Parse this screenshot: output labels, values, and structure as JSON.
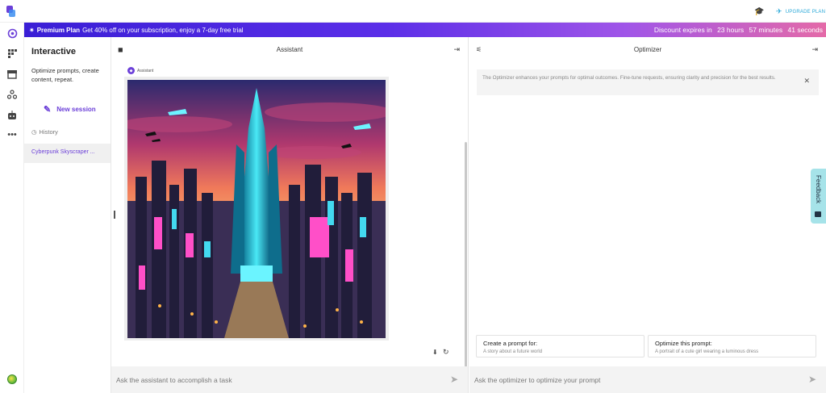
{
  "topbar": {
    "logo": "app-logo",
    "course_icon": "graduation-cap-icon",
    "upgrade_label": "UPGRADE PLAN",
    "upgrade_icon": "rocket-icon"
  },
  "promo": {
    "icon": "sparkle-icon",
    "plan_name": "Premium Plan",
    "message": "Get 40% off on your subscription, enjoy a 7-day free trial",
    "expires_label": "Discount expires in",
    "hours": "23 hours",
    "minutes": "57 minutes",
    "seconds": "41 seconds"
  },
  "rail": {
    "items": [
      "assistant-swirl-icon",
      "apps-grid-icon",
      "store-icon",
      "workflow-icon",
      "bot-icon",
      "more-dots-icon"
    ],
    "active": "assistant-swirl-icon"
  },
  "sidebar": {
    "title": "Interactive",
    "description": "Optimize prompts, create content, repeat.",
    "new_session": "New session",
    "history_label": "History",
    "history_items": [
      "Cyberpunk Skyscraper ..."
    ]
  },
  "assistant": {
    "title": "Assistant",
    "message_author": "Assistant",
    "input_placeholder": "Ask the assistant to accomplish a task",
    "actions": [
      "download-icon",
      "refresh-icon"
    ]
  },
  "optimizer": {
    "title": "Optimizer",
    "notice": "The Optimizer enhances your prompts for optimal outcomes. Fine-tune requests, ensuring clarity and precision for the best results.",
    "cards": [
      {
        "title": "Create a prompt for:",
        "subtitle": "A story about a future world"
      },
      {
        "title": "Optimize this prompt:",
        "subtitle": "A portrait of a cute girl wearing a luminous dress"
      }
    ],
    "input_placeholder": "Ask the optimizer to optimize your prompt"
  },
  "feedback": {
    "label": "Feedback"
  },
  "colors": {
    "accent": "#6b3fd8",
    "upgrade": "#29a8d8",
    "feedback_bg": "#a6e3e9"
  }
}
